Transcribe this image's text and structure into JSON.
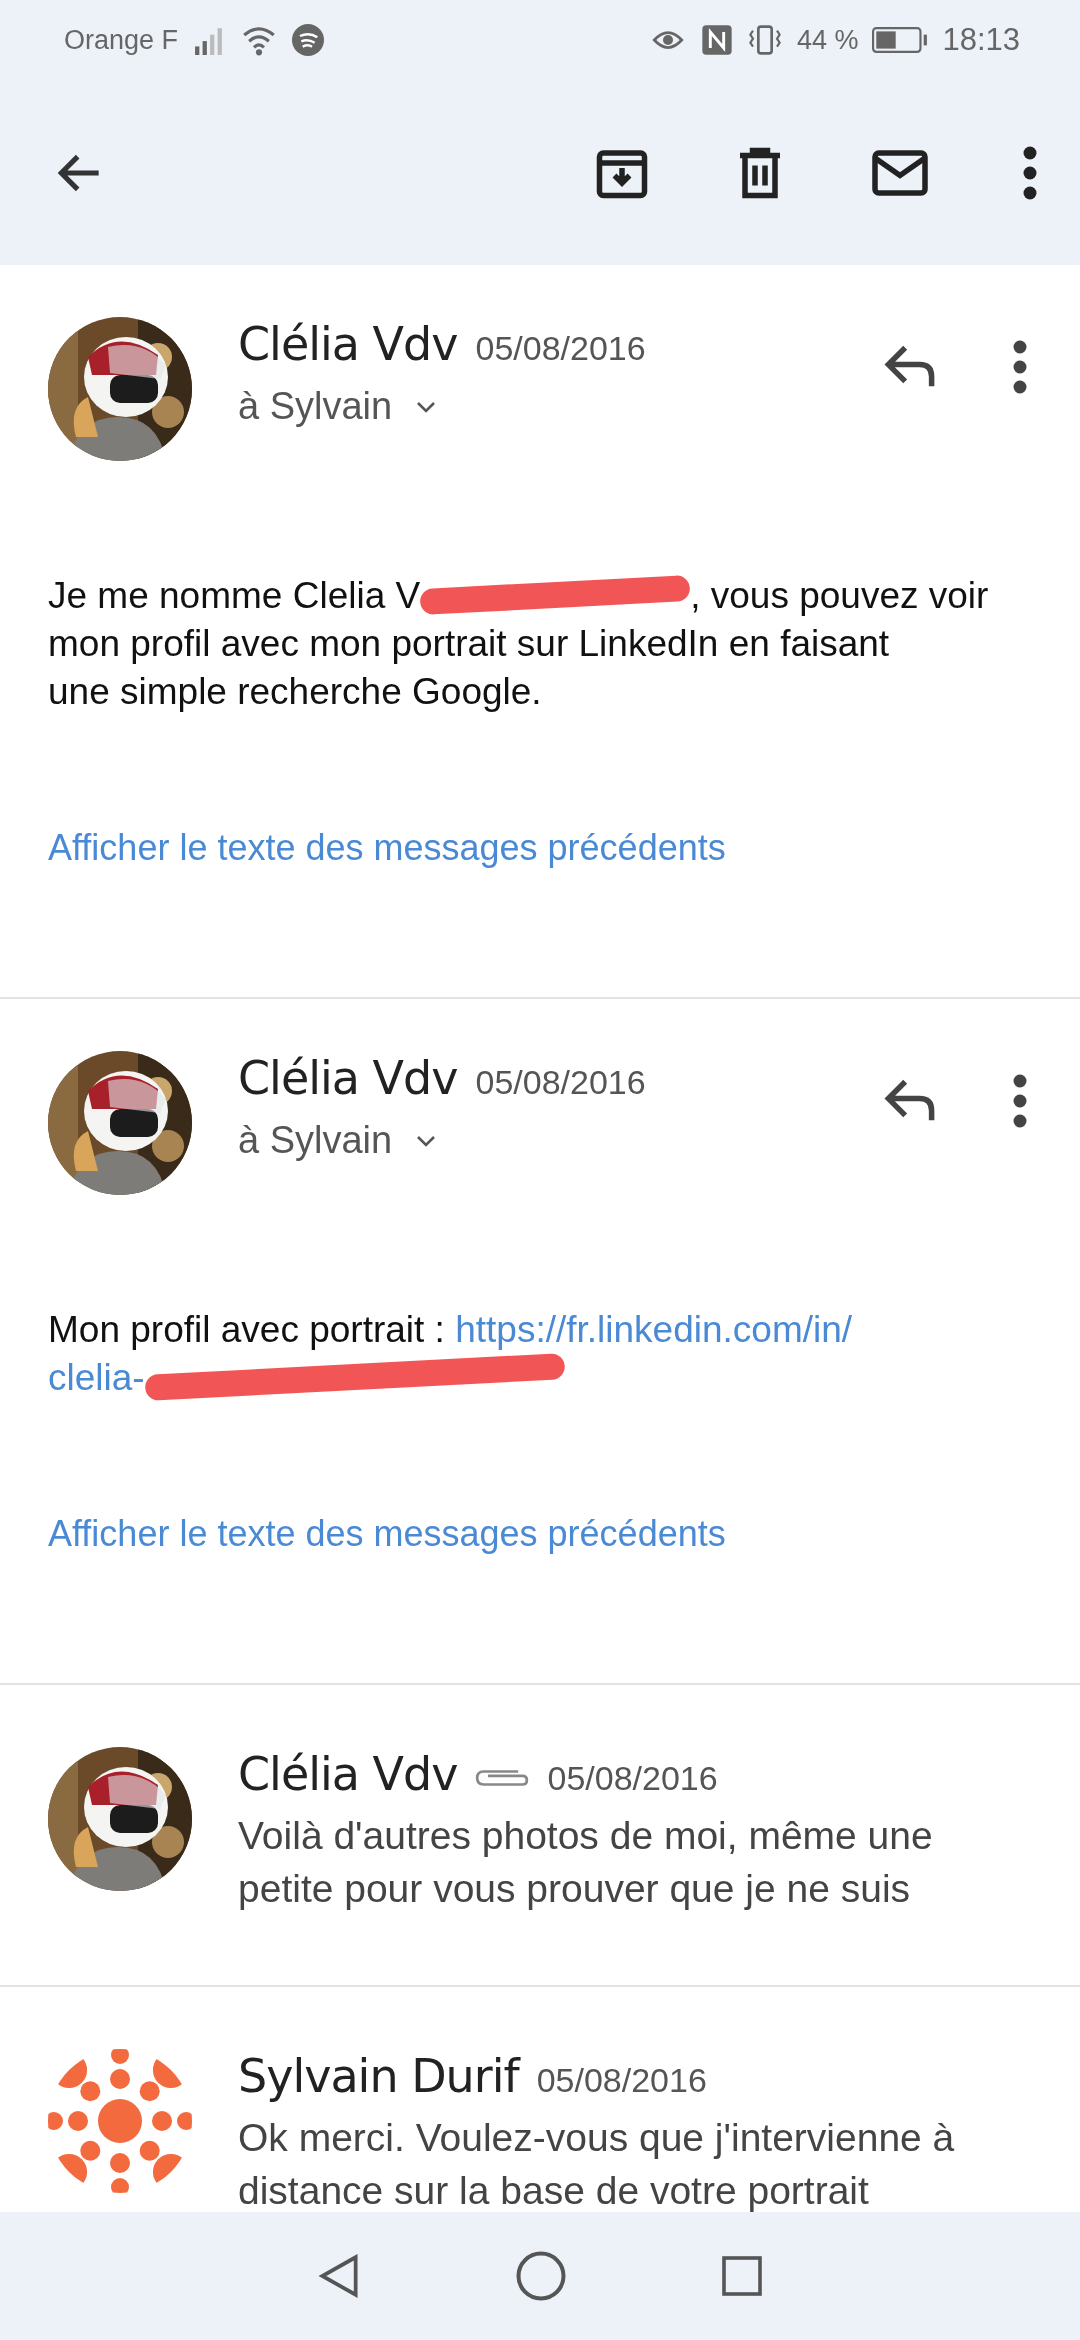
{
  "status_bar": {
    "carrier": "Orange F",
    "battery": "44 %",
    "time": "18:13"
  },
  "messages": [
    {
      "kind": "expanded",
      "avatar": {
        "kind": "picture"
      },
      "sender": "Clélia Vdv",
      "date": "05/08/2016",
      "recipient": "à Sylvain",
      "body": [
        [
          {
            "kind": "text",
            "text": "Je me nomme Clelia V"
          },
          {
            "kind": "redaction"
          },
          {
            "kind": "text",
            "text": ", vous pouvez voir"
          }
        ],
        [
          {
            "kind": "text",
            "text": "mon profil avec mon portrait sur LinkedIn en faisant"
          }
        ],
        [
          {
            "kind": "text",
            "text": "une simple recherche Google."
          }
        ]
      ],
      "show_quoted": "Afficher le texte des messages précédents"
    },
    {
      "kind": "expanded",
      "avatar": {
        "kind": "picture"
      },
      "sender": "Clélia Vdv",
      "date": "05/08/2016",
      "recipient": "à Sylvain",
      "body": [
        [
          {
            "kind": "text",
            "text": "Mon profil avec portrait : "
          },
          {
            "kind": "link",
            "text": "https://fr.linkedin.com/in/"
          }
        ],
        [
          {
            "kind": "link",
            "text": "clelia-"
          },
          {
            "kind": "redaction"
          }
        ]
      ],
      "show_quoted": "Afficher le texte des messages précédents"
    },
    {
      "kind": "collapsed",
      "avatar": {
        "kind": "picture"
      },
      "sender": "Clélia Vdv",
      "attachment": true,
      "date": "05/08/2016",
      "snippet": "Voilà d'autres photos de moi, même une petite pour vous prouver que je ne suis"
    },
    {
      "kind": "collapsed",
      "avatar": {
        "kind": "logo"
      },
      "sender": "Sylvain Durif",
      "attachment": false,
      "date": "05/08/2016",
      "snippet": "Ok merci. Voulez-vous que j'intervienne à distance sur la base de votre portrait"
    }
  ]
}
